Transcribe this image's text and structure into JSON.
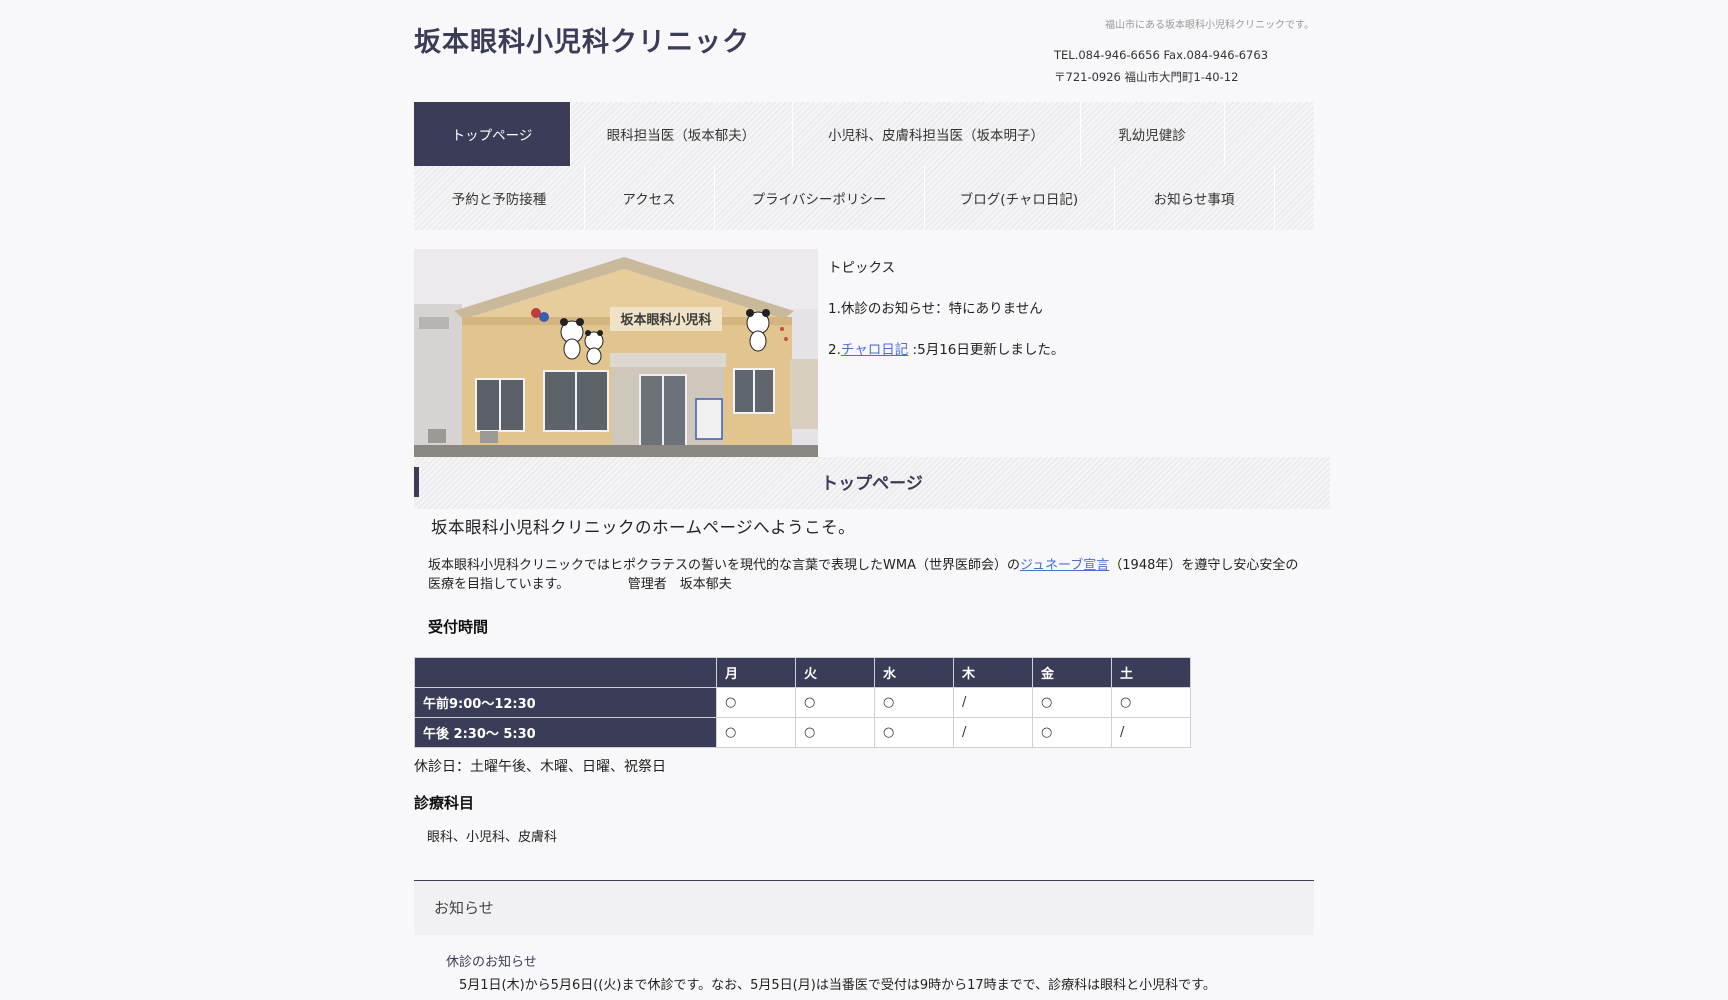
{
  "header": {
    "site_title": "坂本眼科小児科クリニック",
    "tagline": "福山市にある坂本眼科小児科クリニックです。",
    "tel": "TEL.084-946-6656 Fax.084-946-6763",
    "address": "〒721-0926 福山市大門町1-40-12"
  },
  "nav": {
    "items": [
      {
        "label": "トップページ",
        "active": true
      },
      {
        "label": "眼科担当医（坂本郁夫）"
      },
      {
        "label": "小児科、皮膚科担当医（坂本明子）"
      },
      {
        "label": "乳幼児健診"
      },
      {
        "label": "予約と予防接種"
      },
      {
        "label": "アクセス"
      },
      {
        "label": "プライバシーポリシー"
      },
      {
        "label": "ブログ(チャロ日記)"
      },
      {
        "label": "お知らせ事項"
      }
    ]
  },
  "hero": {
    "sign": "坂本眼科小児科"
  },
  "topics": {
    "title": "トピックス",
    "item1": "1.休診のお知らせ：特にありません",
    "item2_prefix": "2.",
    "item2_link": "チャロ日記",
    "item2_suffix": " :5月16日更新しました。"
  },
  "main": {
    "section_title": "トップページ",
    "welcome": "坂本眼科小児科クリニックのホームページへようこそ。",
    "para_before": "坂本眼科小児科クリニックではヒポクラテスの誓いを現代的な言葉で表現したWMA（世界医師会）の",
    "para_link": "ジュネーブ宣言",
    "para_after": "（1948年）を遵守し安心安全の医療を目指しています。　　　　　管理者　坂本郁夫",
    "hours_heading": "受付時間"
  },
  "hours_table": {
    "days": [
      "月",
      "火",
      "水",
      "木",
      "金",
      "土"
    ],
    "rows": [
      {
        "label": "午前9:00～12:30",
        "cells": [
          "○",
          "○",
          "○",
          "/",
          "○",
          "○"
        ]
      },
      {
        "label": "午後 2:30～ 5:30",
        "cells": [
          "○",
          "○",
          "○",
          "/",
          "○",
          "/"
        ]
      }
    ]
  },
  "closed_days": "休診日：土曜午後、木曜、日曜、祝祭日",
  "departments": {
    "heading": "診療科目",
    "list": "眼科、小児科、皮膚科"
  },
  "notice": {
    "title": "お知らせ",
    "subtitle": "休診のお知らせ",
    "text": "5月1日(木)から5月6日((火)まで休診です。なお、5月5日(月)は当番医で受付は9時から17時までで、診療科は眼科と小児科です。"
  },
  "colors": {
    "accent": "#3a3c58",
    "link": "#4a6fd0"
  }
}
